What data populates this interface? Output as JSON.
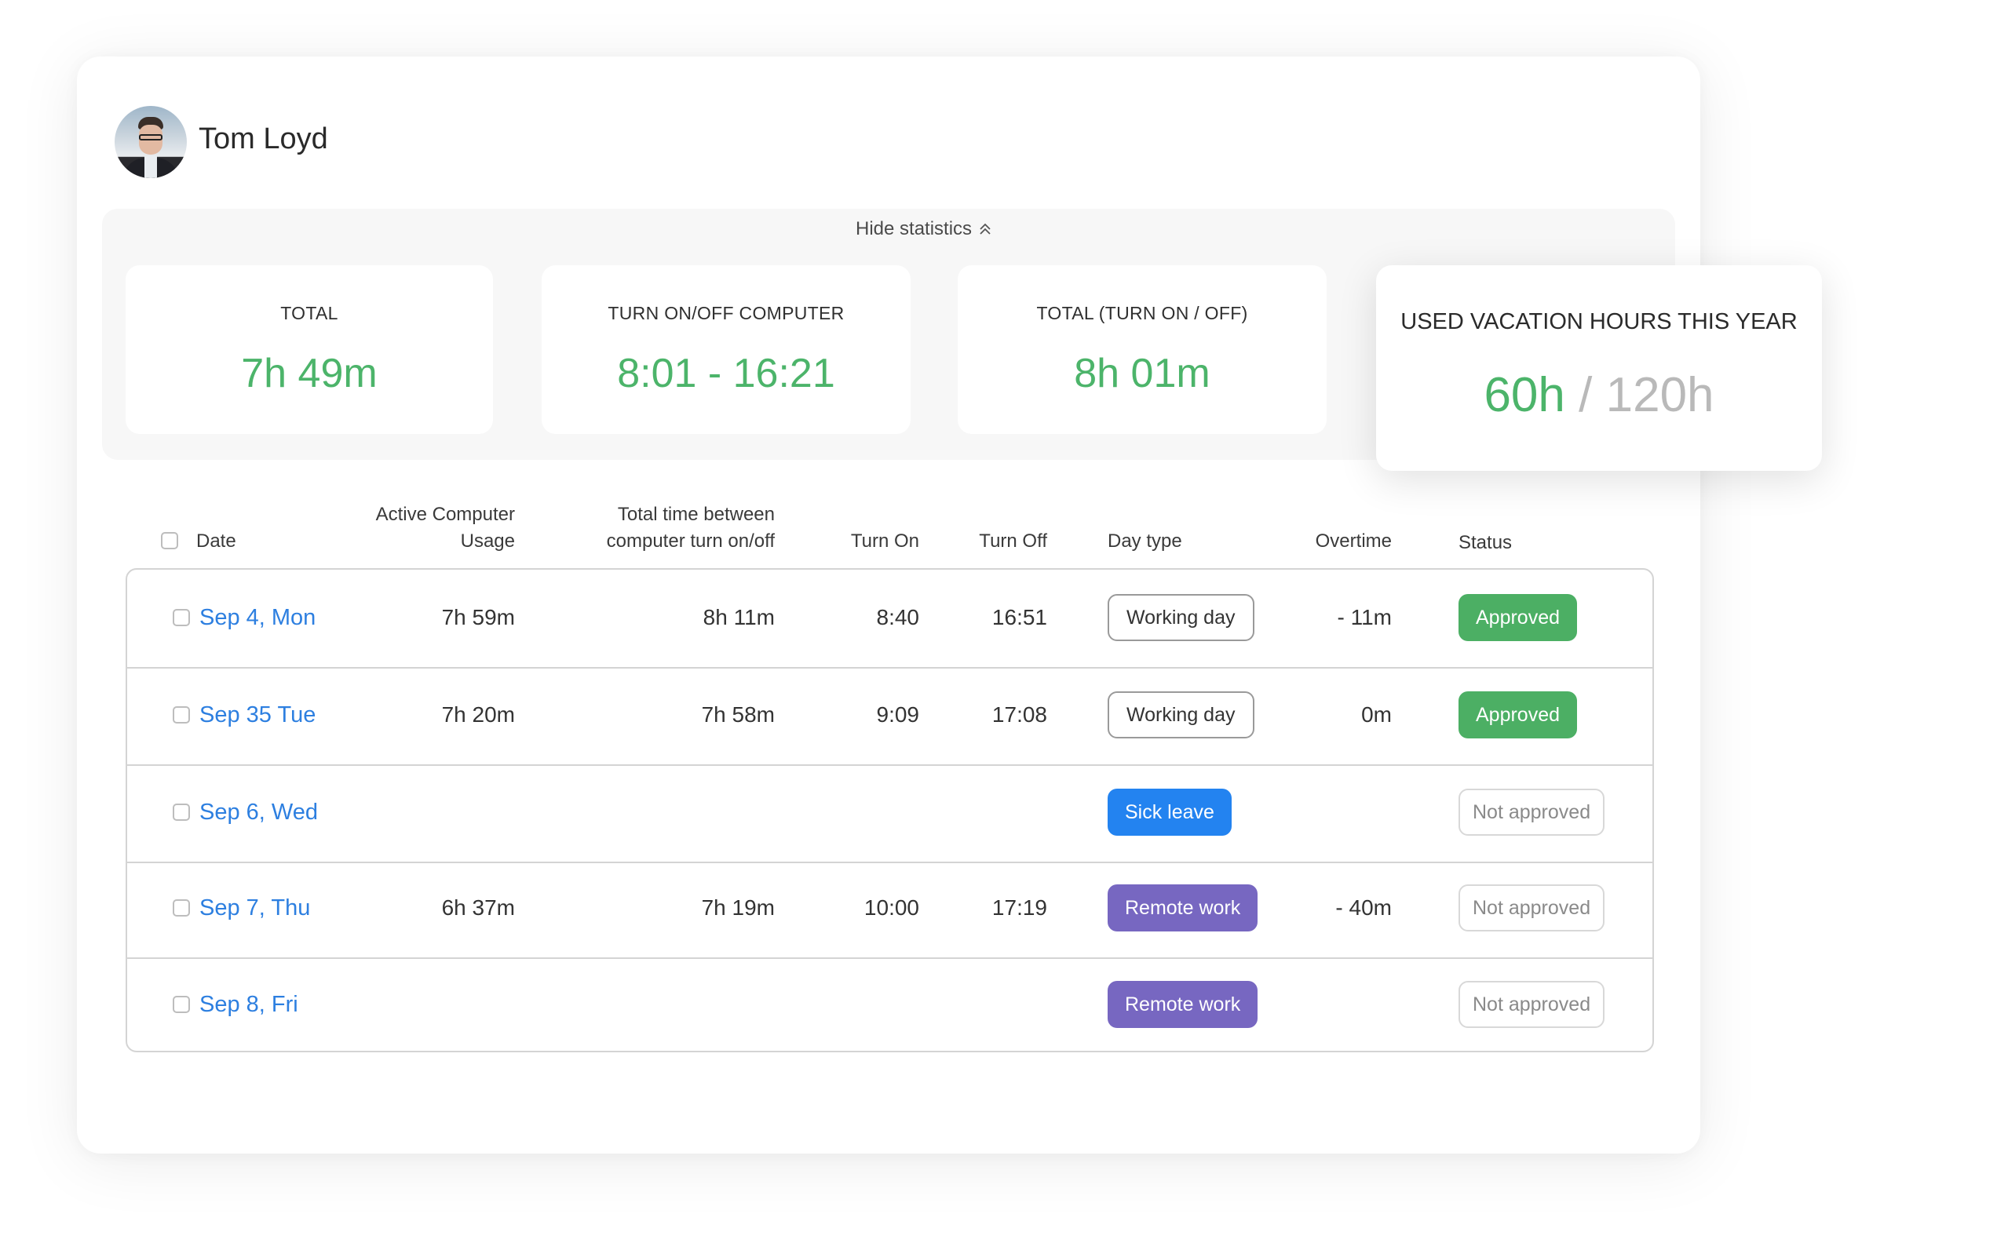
{
  "user": {
    "name": "Tom Loyd"
  },
  "stats": {
    "toggle_label": "Hide statistics",
    "cards": [
      {
        "label": "TOTAL",
        "value": "7h 49m"
      },
      {
        "label": "TURN ON/OFF COMPUTER",
        "value": "8:01 - 16:21"
      },
      {
        "label": "TOTAL (TURN ON / OFF)",
        "value": "8h 01m"
      }
    ],
    "vacation": {
      "label": "USED VACATION HOURS THIS YEAR",
      "used": "60h",
      "separator": "/",
      "total": "120h"
    }
  },
  "table": {
    "headers": {
      "date": "Date",
      "active_line1": "Active Computer",
      "active_line2": "Usage",
      "between_line1": "Total time between",
      "between_line2": "computer turn on/off",
      "turn_on": "Turn On",
      "turn_off": "Turn Off",
      "day_type": "Day type",
      "overtime": "Overtime",
      "status": "Status"
    },
    "rows": [
      {
        "date": "Sep 4, Mon",
        "active": "7h 59m",
        "between": "8h 11m",
        "turn_on": "8:40",
        "turn_off": "16:51",
        "day_type": "Working day",
        "day_type_style": "outline",
        "overtime": "- 11m",
        "status": "Approved",
        "status_style": "approved"
      },
      {
        "date": "Sep  35 Tue",
        "active": "7h 20m",
        "between": "7h 58m",
        "turn_on": "9:09",
        "turn_off": "17:08",
        "day_type": "Working day",
        "day_type_style": "outline",
        "overtime": "0m",
        "status": "Approved",
        "status_style": "approved"
      },
      {
        "date": "Sep 6, Wed",
        "active": "",
        "between": "",
        "turn_on": "",
        "turn_off": "",
        "day_type": "Sick leave",
        "day_type_style": "sick",
        "overtime": "",
        "status": "Not approved",
        "status_style": "notapproved"
      },
      {
        "date": "Sep 7, Thu",
        "active": "6h 37m",
        "between": "7h 19m",
        "turn_on": "10:00",
        "turn_off": "17:19",
        "day_type": "Remote work",
        "day_type_style": "remote",
        "overtime": "- 40m",
        "status": "Not approved",
        "status_style": "notapproved"
      },
      {
        "date": "Sep 8, Fri",
        "active": "",
        "between": "",
        "turn_on": "",
        "turn_off": "",
        "day_type": "Remote work",
        "day_type_style": "remote",
        "overtime": "",
        "status": "Not approved",
        "status_style": "notapproved"
      }
    ]
  },
  "colors": {
    "accent_green": "#4cb46a",
    "approved": "#4caf64",
    "link_blue": "#2d7fe0",
    "sick_leave": "#2383f0",
    "remote_work": "#7767c1"
  }
}
